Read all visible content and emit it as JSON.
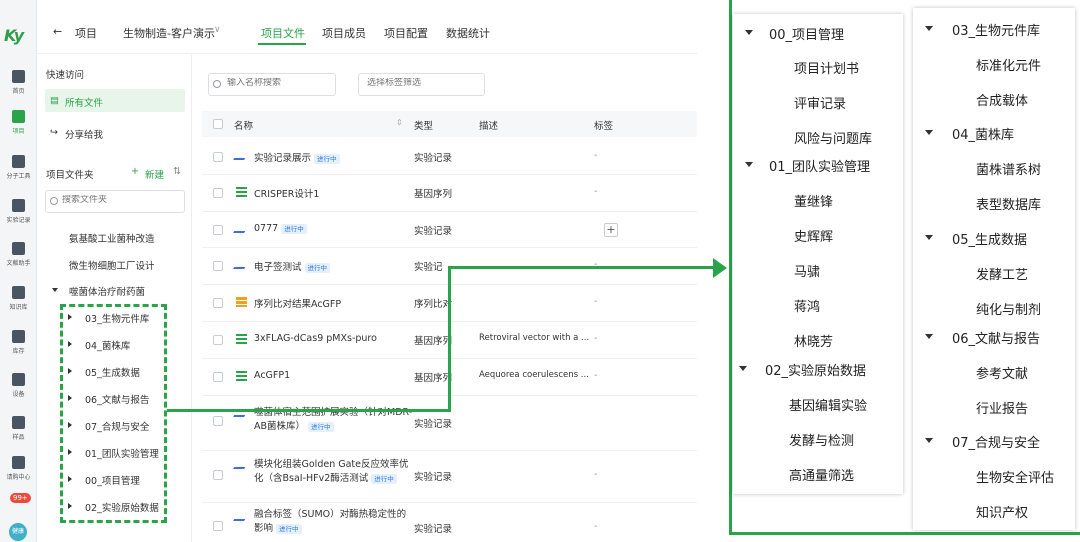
{
  "colors": {
    "accent": "#2aa34a",
    "tag_blue": "#2f7be0"
  },
  "rail": {
    "logo": "Ky",
    "items": [
      {
        "icon": "home-icon",
        "label": "首页"
      },
      {
        "icon": "project-icon",
        "label": "项目"
      },
      {
        "icon": "molecule-tool-icon",
        "label": "分子工具"
      },
      {
        "icon": "lab-record-icon",
        "label": "实验记录"
      },
      {
        "icon": "literature-icon",
        "label": "文献助手"
      },
      {
        "icon": "knowledge-icon",
        "label": "知识库"
      },
      {
        "icon": "inventory-icon",
        "label": "库存"
      },
      {
        "icon": "device-icon",
        "label": "设备"
      },
      {
        "icon": "sample-icon",
        "label": "样品"
      },
      {
        "icon": "request-icon",
        "label": "请购中心"
      }
    ],
    "badge": "99+",
    "avatar": "健康"
  },
  "header": {
    "back_label": "项目",
    "project_name": "生物制造-客户演示",
    "tabs": [
      "项目文件",
      "项目成员",
      "项目配置",
      "数据统计"
    ]
  },
  "sidebar": {
    "quick_access": "快速访问",
    "all_files": "所有文件",
    "shared": "分享给我",
    "folders_title": "项目文件夹",
    "new_label": "新建",
    "search_placeholder": "搜索文件夹",
    "folders": [
      "氨基酸工业菌种改造",
      "微生物细胞工厂设计",
      "噬菌体治疗耐药菌"
    ],
    "subfolders": [
      "03_生物元件库",
      "04_菌株库",
      "05_生成数据",
      "06_文献与报告",
      "07_合规与安全",
      "01_团队实验管理",
      "00_项目管理",
      "02_实验原始数据"
    ]
  },
  "main": {
    "search_placeholder": "输入名称搜索",
    "filter_placeholder": "选择标签筛选",
    "columns": [
      "名称",
      "类型",
      "描述",
      "标签"
    ],
    "rows": [
      {
        "name": "实验记录展示",
        "status": "进行中",
        "type": "实验记录",
        "desc": "",
        "tag": "-"
      },
      {
        "name": "CRISPER设计1",
        "status": "",
        "type": "基因序列",
        "desc": "",
        "tag": "-"
      },
      {
        "name": "0777",
        "status": "进行中",
        "type": "实验记录",
        "desc": "",
        "tag": "+"
      },
      {
        "name": "电子签测试",
        "status": "进行中",
        "type": "实验记",
        "desc": "",
        "tag": "-"
      },
      {
        "name": "序列比对结果AcGFP",
        "status": "",
        "type": "序列比对",
        "desc": "",
        "tag": "-"
      },
      {
        "name": "3xFLAG-dCas9 pMXs-puro",
        "status": "",
        "type": "基因序列",
        "desc": "Retroviral vector with a ...",
        "tag": "-"
      },
      {
        "name": "AcGFP1",
        "status": "",
        "type": "基因序列",
        "desc": "Aequorea coerulescens ...",
        "tag": "-"
      },
      {
        "name": "噬菌体宿主范围扩展实验（针对MDR-AB菌株库）",
        "status": "进行中",
        "type": "实验记录",
        "desc": "",
        "tag": ""
      },
      {
        "name": "模块化组装Golden Gate反应效率优化（含BsaI-HFv2酶活测试",
        "status": "进行中",
        "type": "实验记录",
        "desc": "",
        "tag": "-"
      },
      {
        "name": "融合标签（SUMO）对酶热稳定性的影响",
        "status": "进行中",
        "type": "实验记录",
        "desc": "",
        "tag": "-"
      }
    ]
  },
  "tree_left": [
    {
      "group": "00_项目管理",
      "items": [
        "项目计划书",
        "评审记录",
        "风险与问题库"
      ]
    },
    {
      "group": "01_团队实验管理",
      "items": [
        "董继锋",
        "史辉辉",
        "马骕",
        "蒋鸿",
        "林晓芳"
      ]
    },
    {
      "group": "02_实验原始数据",
      "items": [
        "基因编辑实验",
        "发酵与检测",
        "高通量筛选"
      ]
    }
  ],
  "tree_right": [
    {
      "group": "03_生物元件库",
      "items": [
        "标准化元件",
        "合成载体"
      ]
    },
    {
      "group": "04_菌株库",
      "items": [
        "菌株谱系树",
        "表型数据库"
      ]
    },
    {
      "group": "05_生成数据",
      "items": [
        "发酵工艺",
        "纯化与制剂"
      ]
    },
    {
      "group": "06_文献与报告",
      "items": [
        "参考文献",
        "行业报告"
      ]
    },
    {
      "group": "07_合规与安全",
      "items": [
        "生物安全评估",
        "知识产权"
      ]
    }
  ]
}
